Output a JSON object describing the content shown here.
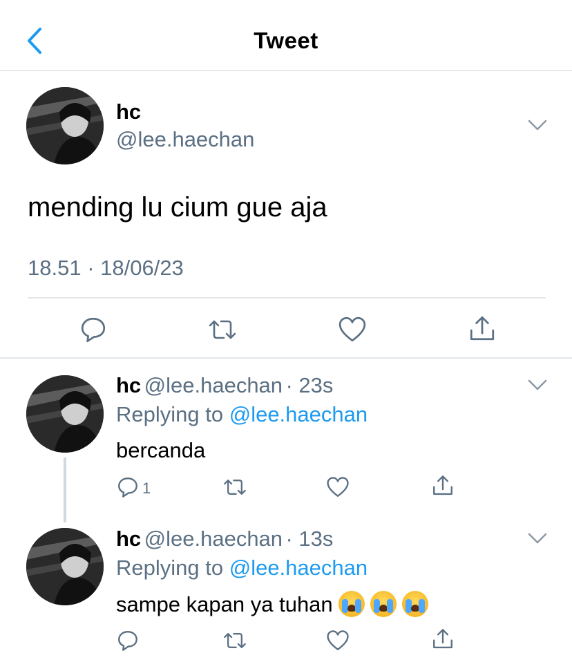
{
  "header": {
    "title": "Tweet"
  },
  "main_tweet": {
    "name": "hc",
    "handle": "@lee.haechan",
    "text": "mending lu cium gue aja",
    "timestamp": "18.51 · 18/06/23"
  },
  "replies": [
    {
      "name": "hc",
      "handle": "@lee.haechan",
      "age": "· 23s",
      "replying_to_prefix": "Replying to",
      "replying_to": "@lee.haechan",
      "text": "bercanda",
      "reply_count": "1",
      "emojis": []
    },
    {
      "name": "hc",
      "handle": "@lee.haechan",
      "age": "· 13s",
      "replying_to_prefix": "Replying to",
      "replying_to": "@lee.haechan",
      "text": "sampe kapan ya tuhan",
      "reply_count": "",
      "emojis": [
        "loudly-crying-face",
        "loudly-crying-face",
        "loudly-crying-face"
      ]
    }
  ],
  "colors": {
    "accent": "#1d9bf0",
    "secondary_text": "#5b7083",
    "divider": "#e3e7ea",
    "icon": "#5b7083"
  },
  "icons": {
    "back": "chevron-left-icon",
    "more": "chevron-down-icon",
    "reply": "speech-bubble-icon",
    "retweet": "retweet-icon",
    "like": "heart-icon",
    "share": "share-upload-icon"
  }
}
